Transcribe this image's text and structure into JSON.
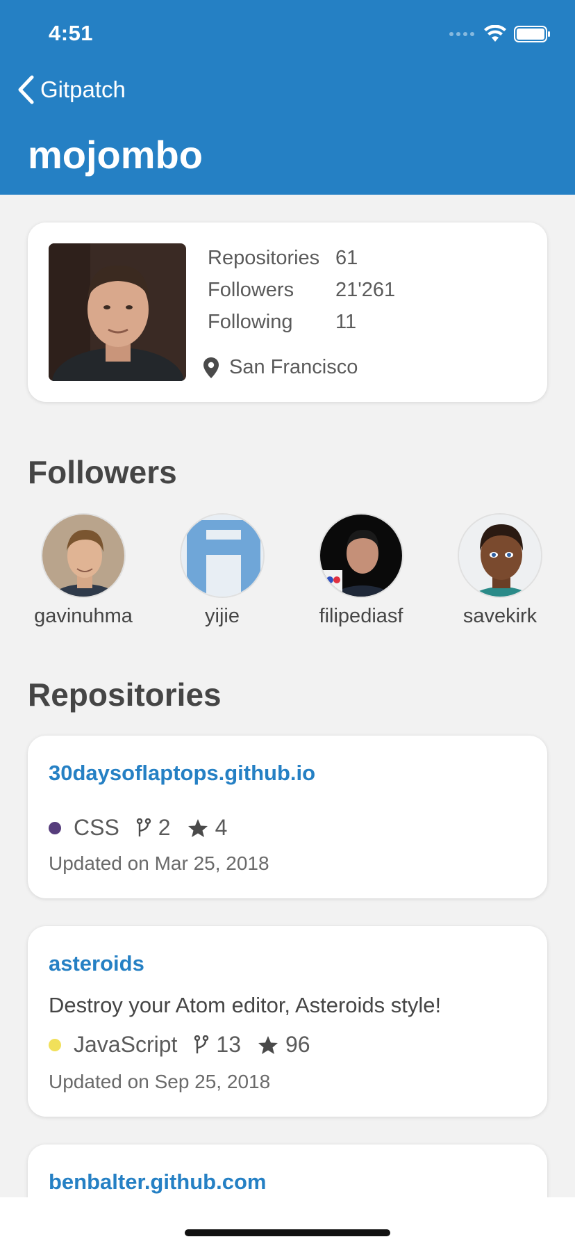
{
  "status": {
    "time": "4:51"
  },
  "nav": {
    "back_label": "Gitpatch",
    "title": "mojombo"
  },
  "profile": {
    "stats": [
      {
        "label": "Repositories",
        "value": "61"
      },
      {
        "label": "Followers",
        "value": "21'261"
      },
      {
        "label": "Following",
        "value": "11"
      }
    ],
    "location": "San Francisco"
  },
  "followers_section": {
    "title": "Followers",
    "items": [
      {
        "name": "gavinuhma"
      },
      {
        "name": "yijie"
      },
      {
        "name": "filipediasf"
      },
      {
        "name": "savekirk"
      }
    ]
  },
  "repos_section": {
    "title": "Repositories",
    "items": [
      {
        "name": "30daysoflaptops.github.io",
        "description": "",
        "language": "CSS",
        "language_color": "#563d7c",
        "forks": "2",
        "stars": "4",
        "updated": "Updated on Mar 25, 2018"
      },
      {
        "name": "asteroids",
        "description": "Destroy your Atom editor, Asteroids style!",
        "language": "JavaScript",
        "language_color": "#f1e05a",
        "forks": "13",
        "stars": "96",
        "updated": "Updated on Sep 25, 2018"
      },
      {
        "name": "benbalter.github.com"
      }
    ]
  },
  "colors": {
    "header": "#2580c4",
    "link": "#2580c4",
    "background": "#f2f2f2"
  }
}
